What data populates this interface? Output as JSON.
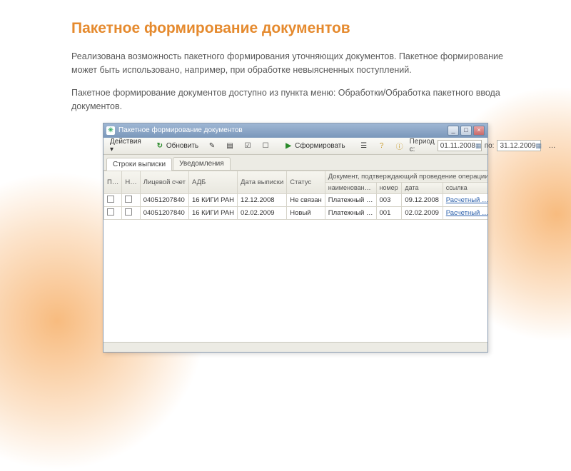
{
  "page": {
    "title": "Пакетное формирование документов",
    "para1": "Реализована возможность пакетного формирования уточняющих документов. Пакетное формирование может быть использовано, например, при обработке невыясненных поступлений.",
    "para2": "Пакетное формирование документов доступно из пункта меню: Обработки/Обработка пакетного ввода документов."
  },
  "window": {
    "title": "Пакетное формирование документов",
    "toolbar": {
      "actions": "Действия ▾",
      "refresh": "Обновить",
      "form": "Сформировать"
    },
    "period": {
      "label": "Период с:",
      "from": "01.11.2008",
      "to_label": "по:",
      "to": "31.12.2009"
    },
    "tabs": {
      "t1": "Строки выписки",
      "t2": "Уведомления"
    },
    "columns": {
      "c1": "П…",
      "c2": "Н…",
      "c3": "Лицевой счет",
      "c4": "АДБ",
      "c5": "Дата выписки",
      "c6": "Статус",
      "group": "Документ, подтверждающий проведение операции",
      "g1": "наименован…",
      "g2": "номер",
      "g3": "дата",
      "g4": "ссылка"
    },
    "rows": [
      {
        "acct": "04051207840",
        "adb": "16 КИГИ РАН",
        "date": "12.12.2008",
        "status": "Не связан",
        "docname": "Платежный …",
        "docnum": "003",
        "docdate": "09.12.2008",
        "link": "Расчетный …"
      },
      {
        "acct": "04051207840",
        "adb": "16 КИГИ РАН",
        "date": "02.02.2009",
        "status": "Новый",
        "docname": "Платежный …",
        "docnum": "001",
        "docdate": "02.02.2009",
        "link": "Расчетный …"
      }
    ]
  }
}
